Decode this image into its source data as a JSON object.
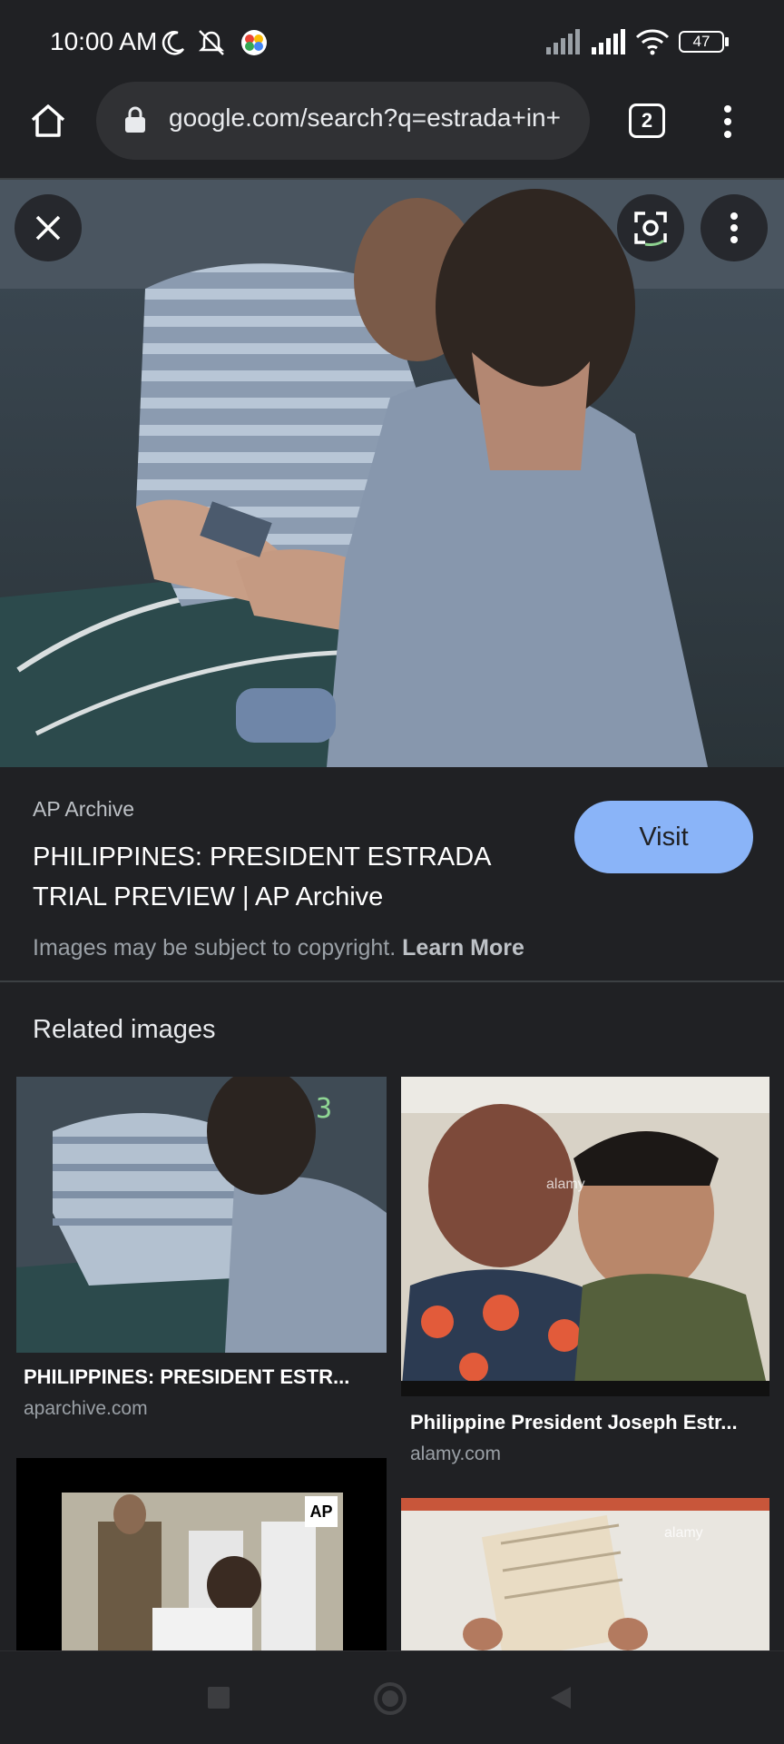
{
  "status_bar": {
    "time": "10:00 AM",
    "battery": "47",
    "icons": [
      "moon-icon",
      "notifications-off-icon",
      "app-notification-icon",
      "signal-icon",
      "signal-icon",
      "wifi-icon",
      "battery-icon"
    ]
  },
  "browser": {
    "url": "google.com/search?q=estrada+in+",
    "tab_count": "2"
  },
  "result": {
    "source": "AP Archive",
    "title": "PHILIPPINES: PRESIDENT ESTRADA TRIAL PREVIEW | AP Archive",
    "visit_label": "Visit",
    "copyright_text": "Images may be subject to copyright.",
    "learn_more": "Learn More"
  },
  "related": {
    "heading": "Related images",
    "items": [
      {
        "title": "PHILIPPINES: PRESIDENT ESTR...",
        "domain": "aparchive.com",
        "overlay": "3"
      },
      {
        "title": "Philippine President Joseph Estr...",
        "domain": "alamy.com",
        "overlay": "alamy"
      },
      {
        "title": "",
        "domain": "",
        "overlay": "AP"
      },
      {
        "title": "",
        "domain": "",
        "overlay": "alamy"
      }
    ]
  },
  "colors": {
    "background": "#202124",
    "accent": "#8ab4f8"
  }
}
